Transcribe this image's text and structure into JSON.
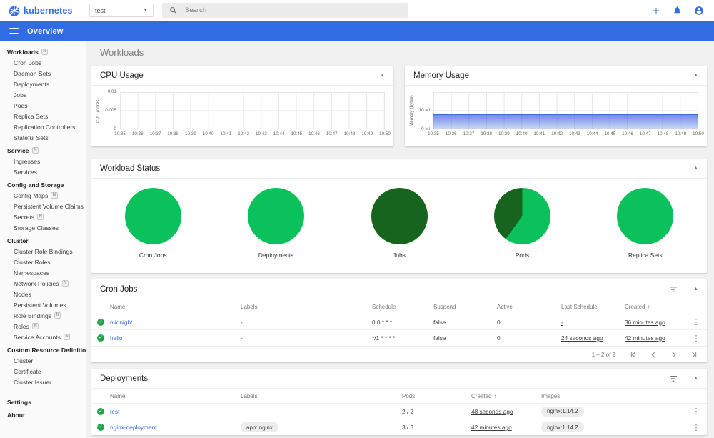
{
  "colors": {
    "brand_blue": "#326ce5",
    "green_light": "#0bc15c",
    "green_dark": "#17641f"
  },
  "header": {
    "brand": "kubernetes",
    "namespace_selected": "test",
    "search_placeholder": "Search"
  },
  "appbar": {
    "title": "Overview"
  },
  "sidebar": {
    "groups": [
      {
        "label": "Workloads",
        "badge": "N",
        "items": [
          {
            "label": "Cron Jobs"
          },
          {
            "label": "Daemon Sets"
          },
          {
            "label": "Deployments"
          },
          {
            "label": "Jobs"
          },
          {
            "label": "Pods"
          },
          {
            "label": "Replica Sets"
          },
          {
            "label": "Replication Controllers"
          },
          {
            "label": "Stateful Sets"
          }
        ]
      },
      {
        "label": "Service",
        "badge": "N",
        "items": [
          {
            "label": "Ingresses"
          },
          {
            "label": "Services"
          }
        ]
      },
      {
        "label": "Config and Storage",
        "items": [
          {
            "label": "Config Maps",
            "badge": "N"
          },
          {
            "label": "Persistent Volume Claims",
            "badge": "N"
          },
          {
            "label": "Secrets",
            "badge": "N"
          },
          {
            "label": "Storage Classes"
          }
        ]
      },
      {
        "label": "Cluster",
        "items": [
          {
            "label": "Cluster Role Bindings"
          },
          {
            "label": "Cluster Roles"
          },
          {
            "label": "Namespaces"
          },
          {
            "label": "Network Policies",
            "badge": "N"
          },
          {
            "label": "Nodes"
          },
          {
            "label": "Persistent Volumes"
          },
          {
            "label": "Role Bindings",
            "badge": "N"
          },
          {
            "label": "Roles",
            "badge": "N"
          },
          {
            "label": "Service Accounts",
            "badge": "N"
          }
        ]
      },
      {
        "label": "Custom Resource Definitions",
        "items": [
          {
            "label": "Cluster"
          },
          {
            "label": "Certificate"
          },
          {
            "label": "Cluster Issuer"
          }
        ]
      }
    ],
    "footer_items": [
      {
        "label": "Settings"
      },
      {
        "label": "About"
      }
    ]
  },
  "page_title": "Workloads",
  "chart_data": [
    {
      "type": "line",
      "title": "CPU Usage",
      "ylabel": "CPU (cores)",
      "yticks": [
        {
          "label": "0.01",
          "pos": 0
        },
        {
          "label": "0.005",
          "pos": 50
        },
        {
          "label": "0",
          "pos": 100
        }
      ],
      "ylim": [
        0,
        0.01
      ],
      "x": [
        "10:35",
        "10:36",
        "10:37",
        "10:38",
        "10:39",
        "10:40",
        "10:41",
        "10:42",
        "10:43",
        "10:44",
        "10:45",
        "10:46",
        "10:47",
        "10:48",
        "10:49",
        "10:50"
      ],
      "series": [],
      "grid": true,
      "note": "no visible series data"
    },
    {
      "type": "area",
      "title": "Memory Usage",
      "ylabel": "Memory (bytes)",
      "yticks": [
        {
          "label": "10 Mi",
          "pos": 50
        },
        {
          "label": "0 Mi",
          "pos": 100
        }
      ],
      "ylim_mi": [
        0,
        20
      ],
      "x": [
        "10:35",
        "10:36",
        "10:37",
        "10:38",
        "10:39",
        "10:40",
        "10:41",
        "10:42",
        "10:43",
        "10:44",
        "10:45",
        "10:46",
        "10:47",
        "10:48",
        "10:49",
        "10:50"
      ],
      "series": [
        {
          "name": "memory usage",
          "values_mi": [
            8,
            8,
            8,
            8,
            8,
            8,
            8,
            8,
            8,
            8,
            8,
            8,
            8,
            8,
            8,
            8
          ]
        }
      ],
      "grid": true
    },
    {
      "type": "pie",
      "title": "Workload Status",
      "pies": [
        {
          "label": "Cron Jobs",
          "slices": [
            {
              "fraction": 1.0,
              "color": "green_light"
            }
          ]
        },
        {
          "label": "Deployments",
          "slices": [
            {
              "fraction": 1.0,
              "color": "green_light"
            }
          ]
        },
        {
          "label": "Jobs",
          "slices": [
            {
              "fraction": 1.0,
              "color": "green_dark"
            }
          ]
        },
        {
          "label": "Pods",
          "slices": [
            {
              "fraction": 0.6,
              "color": "green_light"
            },
            {
              "fraction": 0.4,
              "color": "green_dark"
            }
          ]
        },
        {
          "label": "Replica Sets",
          "slices": [
            {
              "fraction": 1.0,
              "color": "green_light"
            }
          ]
        }
      ]
    }
  ],
  "workload_status": {
    "title": "Workload Status"
  },
  "cron_jobs": {
    "title": "Cron Jobs",
    "columns": [
      "Name",
      "Labels",
      "Schedule",
      "Suspend",
      "Active",
      "Last Schedule",
      "Created"
    ],
    "sorted_column": "Created",
    "sort_arrow": "↑",
    "rows": [
      {
        "status": "ok",
        "name": "midnight",
        "labels": "-",
        "schedule": "0 0 * * *",
        "suspend": "false",
        "active": "0",
        "last_schedule": "-",
        "created": "36 minutes ago"
      },
      {
        "status": "ok",
        "name": "hello",
        "labels": "-",
        "schedule": "*/1 * * * *",
        "suspend": "false",
        "active": "0",
        "last_schedule": "24 seconds ago",
        "created": "42 minutes ago"
      }
    ],
    "pagination": "1 – 2 of 2"
  },
  "deployments": {
    "title": "Deployments",
    "columns": [
      "Name",
      "Labels",
      "Pods",
      "Created",
      "Images"
    ],
    "sorted_column": "Created",
    "sort_arrow": "↑",
    "rows": [
      {
        "status": "ok",
        "name": "test",
        "labels": {
          "text": "-",
          "chip": false
        },
        "pods": "2 / 2",
        "created": "48 seconds ago",
        "images": [
          "nginx:1.14.2"
        ]
      },
      {
        "status": "ok",
        "name": "nginx-deployment",
        "labels": {
          "text": "app: nginx",
          "chip": true
        },
        "pods": "3 / 3",
        "created": "42 minutes ago",
        "images": [
          "nginx:1.14.2"
        ]
      }
    ]
  }
}
